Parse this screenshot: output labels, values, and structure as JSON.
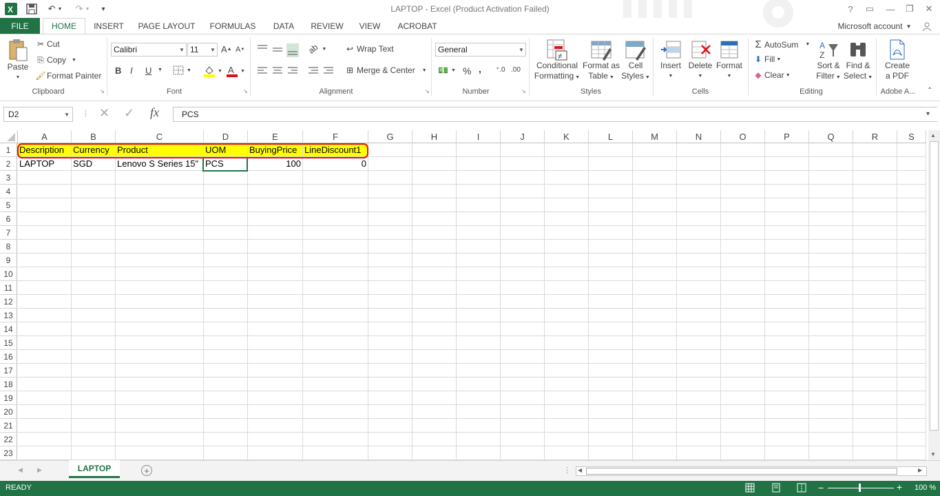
{
  "title": "LAPTOP - Excel (Product Activation Failed)",
  "colors": {
    "accent": "#217346",
    "highlight": "#ffff00",
    "callout": "#e0101a"
  },
  "window": {
    "help": "?",
    "account": "Microsoft account"
  },
  "tabs": [
    "FILE",
    "HOME",
    "INSERT",
    "PAGE LAYOUT",
    "FORMULAS",
    "DATA",
    "REVIEW",
    "VIEW",
    "ACROBAT"
  ],
  "ribbon": {
    "clipboard": {
      "paste": "Paste",
      "cut": "Cut",
      "copy": "Copy",
      "format_painter": "Format Painter",
      "label": "Clipboard"
    },
    "font": {
      "family": "Calibri",
      "size": "11",
      "bold": "B",
      "italic": "I",
      "underline": "U",
      "label": "Font"
    },
    "alignment": {
      "wrap": "Wrap Text",
      "merge": "Merge & Center",
      "label": "Alignment"
    },
    "number": {
      "format": "General",
      "percent": "%",
      "comma": ",",
      "label": "Number"
    },
    "styles": {
      "conditional_1": "Conditional",
      "conditional_2": "Formatting",
      "table_1": "Format as",
      "table_2": "Table",
      "cell_1": "Cell",
      "cell_2": "Styles",
      "label": "Styles"
    },
    "cells": {
      "insert": "Insert",
      "delete": "Delete",
      "format": "Format",
      "label": "Cells"
    },
    "editing": {
      "autosum": "AutoSum",
      "fill": "Fill",
      "clear": "Clear",
      "sort_1": "Sort &",
      "sort_2": "Filter",
      "find_1": "Find &",
      "find_2": "Select",
      "label": "Editing"
    },
    "adobe": {
      "create_1": "Create",
      "create_2": "a PDF",
      "label": "Adobe A..."
    }
  },
  "formula_bar": {
    "name_box": "D2",
    "fx": "fx",
    "value": "PCS"
  },
  "grid": {
    "columns": [
      "A",
      "B",
      "C",
      "D",
      "E",
      "F",
      "G",
      "H",
      "I",
      "J",
      "K",
      "L",
      "M",
      "N",
      "O",
      "P",
      "Q",
      "R",
      "S"
    ],
    "rows": [
      "1",
      "2",
      "3",
      "4",
      "5",
      "6",
      "7",
      "8",
      "9",
      "10",
      "11",
      "12",
      "13",
      "14",
      "15",
      "16",
      "17",
      "18",
      "19",
      "20",
      "21",
      "22",
      "23"
    ],
    "header_row": [
      "Description",
      "Currency",
      "Product",
      "UOM",
      "BuyingPrice",
      "LineDiscount1"
    ],
    "data_row": [
      "LAPTOP",
      "SGD",
      "Lenovo S Series 15\"",
      "PCS",
      "100",
      "0"
    ]
  },
  "sheet_tab": "LAPTOP",
  "status": {
    "mode": "READY",
    "zoom": "100 %"
  }
}
